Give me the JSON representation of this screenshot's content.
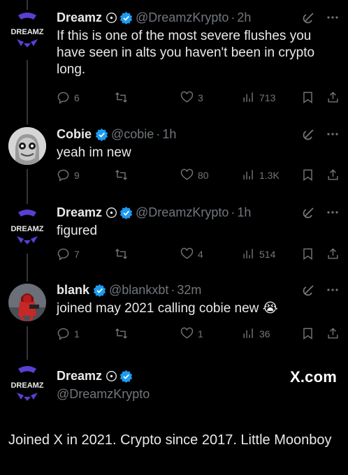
{
  "colors": {
    "background": "#000000",
    "text": "#e7e9ea",
    "muted": "#71767b",
    "verified": "#1d9bf0",
    "brand_purple": "#5b3fd0"
  },
  "icons": {
    "grok": "grok-icon",
    "more": "more-icon",
    "reply": "reply-icon",
    "retweet": "retweet-icon",
    "like": "heart-icon",
    "views": "views-icon",
    "bookmark": "bookmark-icon",
    "share": "share-icon"
  },
  "tweets": [
    {
      "name": "Dreamz",
      "handle": "@DreamzKrypto",
      "time": "2h",
      "avatar_text": "DREAMZ",
      "text": "If this is one of the most severe flushes you have seen in alts you haven't been in crypto long.",
      "replies": "6",
      "likes": "3",
      "views": "713"
    },
    {
      "name": "Cobie",
      "handle": "@cobie",
      "time": "1h",
      "text": "yeah im new",
      "replies": "9",
      "likes": "80",
      "views": "1.3K"
    },
    {
      "name": "Dreamz",
      "handle": "@DreamzKrypto",
      "time": "1h",
      "avatar_text": "DREAMZ",
      "text": "figured",
      "replies": "7",
      "likes": "4",
      "views": "514"
    },
    {
      "name": "blank",
      "handle": "@blankxbt",
      "time": "32m",
      "text": "joined may 2021 calling cobie new 😭",
      "replies": "1",
      "likes": "1",
      "views": "36"
    }
  ],
  "profile_card": {
    "name": "Dreamz",
    "handle": "@DreamzKrypto",
    "avatar_text": "DREAMZ",
    "site": "X.com",
    "text": "Joined X in 2021. Crypto since 2017. Little Moonboy"
  }
}
